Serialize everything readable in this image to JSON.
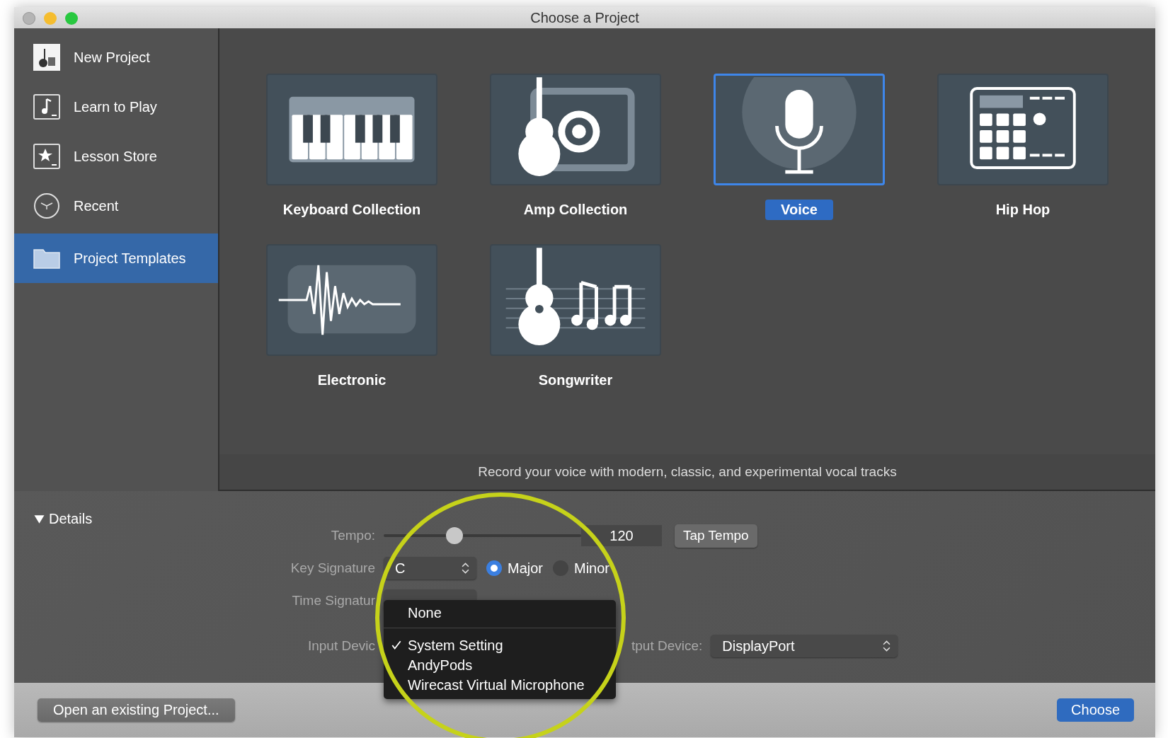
{
  "window": {
    "title": "Choose a Project"
  },
  "sidebar": {
    "items": [
      {
        "label": "New Project",
        "selected": false
      },
      {
        "label": "Learn to Play",
        "selected": false
      },
      {
        "label": "Lesson Store",
        "selected": false
      },
      {
        "label": "Recent",
        "selected": false
      },
      {
        "label": "Project Templates",
        "selected": true
      }
    ]
  },
  "templates": [
    {
      "label": "Keyboard Collection",
      "selected": false
    },
    {
      "label": "Amp Collection",
      "selected": false
    },
    {
      "label": "Voice",
      "selected": true
    },
    {
      "label": "Hip Hop",
      "selected": false
    },
    {
      "label": "Electronic",
      "selected": false
    },
    {
      "label": "Songwriter",
      "selected": false
    }
  ],
  "description": "Record your voice with modern, classic, and experimental vocal tracks",
  "details": {
    "title": "Details",
    "expanded": true,
    "tempo": {
      "label": "Tempo:",
      "level": 0.36,
      "value": "120",
      "button": "Tap Tempo"
    },
    "key": {
      "label": "Key Signature",
      "value": "C",
      "modes": [
        {
          "label": "Major",
          "selected": true
        },
        {
          "label": "Minor",
          "selected": false
        }
      ]
    },
    "time": {
      "label": "Time Signatur"
    },
    "input": {
      "label": "Input Devic"
    },
    "output": {
      "label": "tput Device:",
      "value": "DisplayPort"
    }
  },
  "menu": {
    "items": [
      {
        "kind": "item",
        "label": "None",
        "checked": false
      },
      {
        "kind": "separator"
      },
      {
        "kind": "item",
        "label": "System Setting",
        "checked": true
      },
      {
        "kind": "item",
        "label": "AndyPods",
        "checked": false
      },
      {
        "kind": "item",
        "label": "Wirecast Virtual Microphone",
        "checked": false
      }
    ]
  },
  "footer": {
    "open_button": "Open an existing Project...",
    "choose_button": "Choose"
  }
}
